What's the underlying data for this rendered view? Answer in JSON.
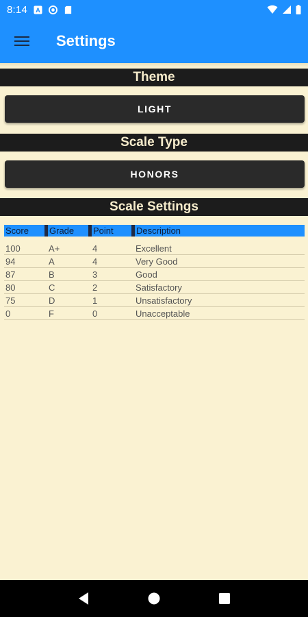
{
  "status_bar": {
    "time": "8:14",
    "left_icons": [
      "keyboard-icon",
      "sync-icon",
      "sd-card-icon"
    ],
    "right_icons": [
      "wifi-icon",
      "signal-icon",
      "battery-icon"
    ]
  },
  "app_bar": {
    "title": "Settings",
    "menu_icon": "hamburger-menu-icon"
  },
  "theme": {
    "header": "Theme",
    "button_label": "LIGHT"
  },
  "scale_type": {
    "header": "Scale Type",
    "button_label": "HONORS"
  },
  "scale_settings": {
    "header": "Scale Settings",
    "columns": [
      "Score",
      "Grade",
      "Point",
      "Description"
    ],
    "rows": [
      [
        "100",
        "A+",
        "4",
        "Excellent"
      ],
      [
        "94",
        "A",
        "4",
        "Very Good"
      ],
      [
        "87",
        "B",
        "3",
        "Good"
      ],
      [
        "80",
        "C",
        "2",
        "Satisfactory"
      ],
      [
        "75",
        "D",
        "1",
        "Unsatisfactory"
      ],
      [
        "0",
        "F",
        "0",
        "Unacceptable"
      ]
    ]
  },
  "colors": {
    "primary": "#1E90FF",
    "background": "#FAF2D2",
    "header_bg": "#1C1C1C",
    "button_bg": "#2A2A2A"
  },
  "nav_bar": {
    "icons": [
      "back-icon",
      "home-icon",
      "recents-icon"
    ]
  }
}
